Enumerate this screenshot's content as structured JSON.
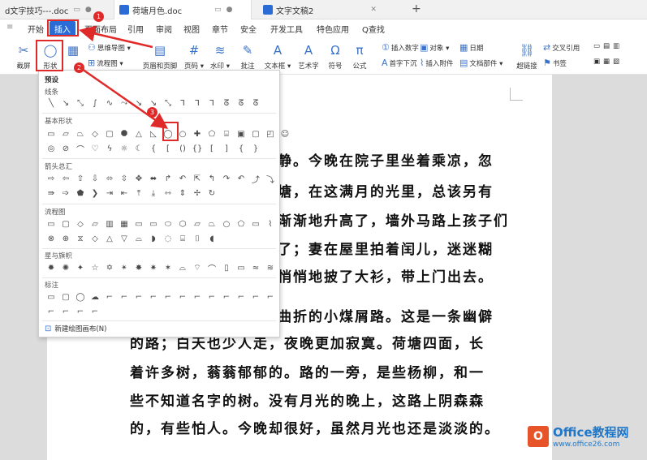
{
  "tabs": [
    {
      "title": "d文字技巧---.doc",
      "active": false
    },
    {
      "title": "荷塘月色.doc",
      "active": true
    },
    {
      "title": "文字文稿2",
      "active": false
    }
  ],
  "plus": "+",
  "menu": [
    "开始",
    "插入",
    "页面布局",
    "引用",
    "审阅",
    "视图",
    "章节",
    "安全",
    "开发工具",
    "特色应用",
    "Q查找"
  ],
  "toolbar": {
    "shape_label": "形状",
    "mindmap": "思维导图",
    "flowchart": "流程图",
    "header_footer": "页眉和页脚",
    "page_number": "页码",
    "watermark": "水印",
    "comment": "批注",
    "textbox": "文本框",
    "wordart": "艺术字",
    "symbol": "符号",
    "formula": "公式",
    "dropcap": "首字下沉",
    "insert_number": "插入数字",
    "object": "对象",
    "date": "日期",
    "attachment": "插入附件",
    "doc_parts": "文档部件",
    "hyperlink": "超链接",
    "crossref": "交叉引用",
    "bookmark": "书签",
    "screenshot": "截屏"
  },
  "dropdown": {
    "preset": "预设",
    "lines": "线条",
    "basic_shapes": "基本形状",
    "arrows": "箭头总汇",
    "flowchart": "流程图",
    "stars": "星与旗帜",
    "callouts": "标注",
    "new_canvas": "新建绘图画布(N)"
  },
  "document_lines": [
    "静。今晚在院子里坐着乘凉，忽",
    "塘，在这满月的光里，总该另有",
    "渐渐地升高了，墙外马路上孩子们",
    "了；妻在屋里拍着闰儿，迷迷糊",
    "悄悄地披了大衫，带上门出去。",
    "曲折的小煤屑路。这是一条幽僻",
    "的路；白天也少人走，夜晚更加寂寞。荷塘四面，长",
    "着许多树，蓊蓊郁郁的。路的一旁，是些杨柳，和一",
    "些不知道名字的树。没有月光的晚上，这路上阴森森",
    "的，有些怕人。今晚却很好，虽然月光也还是淡淡的。"
  ],
  "badges": [
    "1",
    "2",
    "3"
  ],
  "watermark": {
    "brand": "Office教程网",
    "url": "www.office26.com"
  },
  "colors": {
    "accent": "#2b6bd6",
    "annotation": "#e02a2a",
    "brand": "#1f77c9"
  }
}
